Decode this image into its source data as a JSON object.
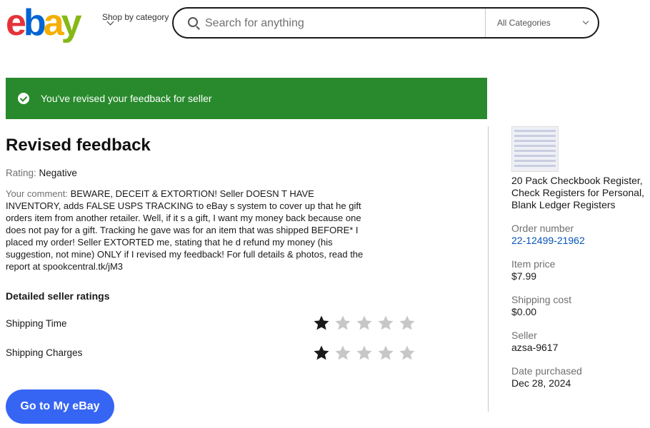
{
  "header": {
    "logo": [
      "e",
      "b",
      "a",
      "y"
    ],
    "logo_colors": [
      "#e53238",
      "#0064d2",
      "#f5af02",
      "#86b817"
    ],
    "shop_by_category": "Shop by category",
    "search_placeholder": "Search for anything",
    "category_selected": "All Categories"
  },
  "banner": {
    "message": "You've revised your feedback for seller",
    "color": "#288a2c"
  },
  "feedback": {
    "title": "Revised feedback",
    "rating_label": "Rating:",
    "rating_value": "Negative",
    "comment_label": "Your comment:",
    "comment_text": "BEWARE, DECEIT & EXTORTION! Seller DOESN T HAVE INVENTORY, adds FALSE USPS TRACKING to eBay s system to cover up that he gift orders item from another retailer. Well, if it s a gift, I want my money back because one does not pay for a gift. Tracking he gave was for an item that was shipped BEFORE* I placed my order! Seller EXTORTED me, stating that he d refund my money (his suggestion, not mine) ONLY if I revised my feedback! For full details & photos, read the report at spookcentral.tk/jM3",
    "dsr_title": "Detailed seller ratings",
    "dsr": [
      {
        "label": "Shipping Time",
        "stars": 1,
        "max": 5
      },
      {
        "label": "Shipping Charges",
        "stars": 1,
        "max": 5
      }
    ]
  },
  "order": {
    "item_title": "20 Pack Checkbook Register, Check Registers for Personal, Blank Ledger Registers",
    "order_number_label": "Order number",
    "order_number": "22-12499-21962",
    "item_price_label": "Item price",
    "item_price": "$7.99",
    "shipping_cost_label": "Shipping cost",
    "shipping_cost": "$0.00",
    "seller_label": "Seller",
    "seller": "azsa-9617",
    "date_label": "Date purchased",
    "date": "Dec 28, 2024"
  },
  "actions": {
    "go_to_my_ebay": "Go to My eBay"
  }
}
